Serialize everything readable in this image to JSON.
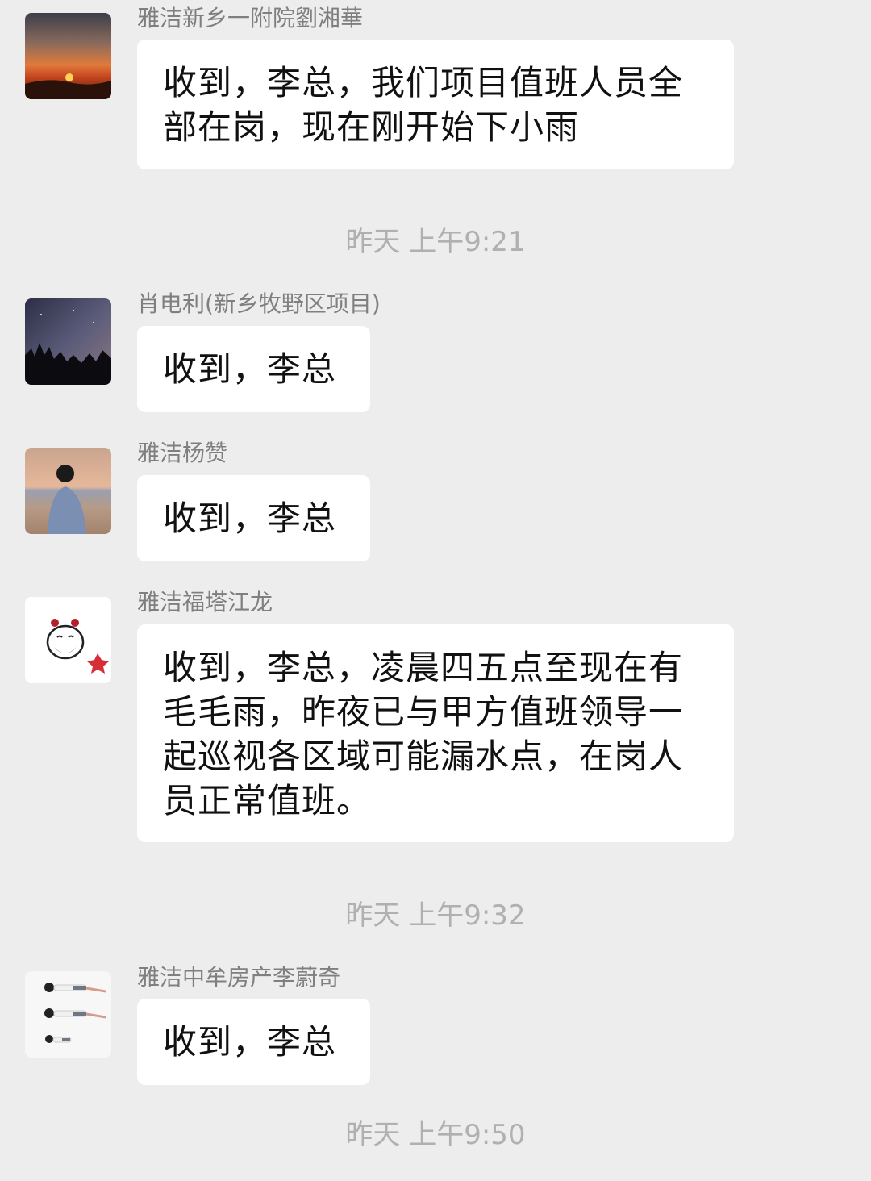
{
  "messages": [
    {
      "sender": "雅洁新乡一附院劉湘華",
      "avatar_icon": "sunset-avatar-icon",
      "text": "收到，李总，我们项目值班人员全部在岗，现在刚开始下小雨"
    },
    {
      "sender": "肖电利(新乡牧野区项目)",
      "avatar_icon": "night-sky-avatar-icon",
      "text": "收到，李总"
    },
    {
      "sender": "雅洁杨赞",
      "avatar_icon": "person-at-beach-avatar-icon",
      "text": "收到，李总"
    },
    {
      "sender": "雅洁福塔江龙",
      "avatar_icon": "cartoon-face-avatar-icon",
      "text": "收到，李总，凌晨四五点至现在有毛毛雨，昨夜已与甲方值班领导一起巡视各区域可能漏水点，在岗人员正常值班。"
    },
    {
      "sender": "雅洁中牟房产李蔚奇",
      "avatar_icon": "illustrated-figures-avatar-icon",
      "text": "收到，李总"
    }
  ],
  "timestamps": [
    "昨天 上午9:21",
    "昨天 上午9:32",
    "昨天 上午9:50"
  ]
}
